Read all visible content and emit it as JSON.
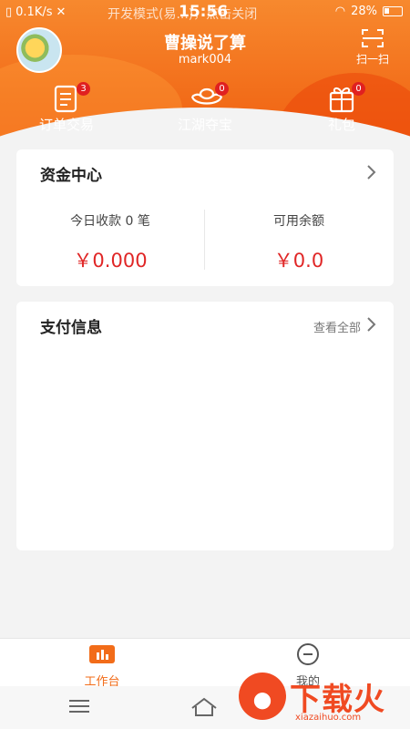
{
  "status_bar": {
    "speed": "0.1K/s",
    "notice": "开发模式(易...)，点击关闭",
    "time": "15:56",
    "battery": "28%"
  },
  "profile": {
    "name": "曹操说了算",
    "account": "mark004",
    "scan_label": "扫一扫"
  },
  "quick_actions": [
    {
      "label": "订单交易",
      "badge": "3",
      "icon": "order-list-icon"
    },
    {
      "label": "江湖夺宝",
      "badge": "0",
      "icon": "ingot-icon"
    },
    {
      "label": "礼包",
      "badge": "0",
      "icon": "gift-icon"
    }
  ],
  "fund_center": {
    "title": "资金中心",
    "today_label": "今日收款 0 笔",
    "today_value": "￥0.000",
    "balance_label": "可用余额",
    "balance_value": "￥0.0"
  },
  "payment_info": {
    "title": "支付信息",
    "view_all": "查看全部"
  },
  "tabbar": {
    "workbench": "工作台",
    "mine": "我的"
  },
  "watermark": {
    "text": "下载火",
    "sub": "xiazaihuo.com"
  },
  "colors": {
    "accent": "#f26c19",
    "money": "#e02626",
    "badge": "#e02020"
  }
}
